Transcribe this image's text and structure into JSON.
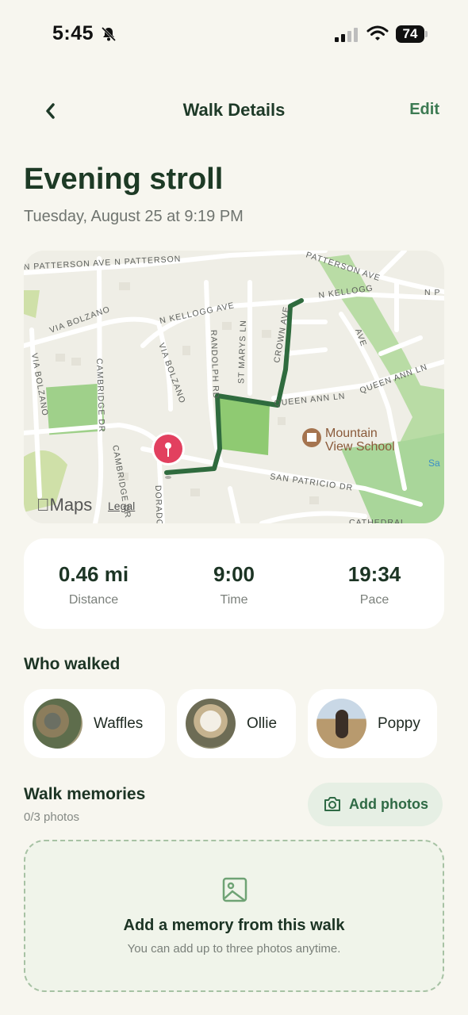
{
  "status_bar": {
    "time": "5:45",
    "battery": "74"
  },
  "nav": {
    "title": "Walk Details",
    "edit_label": "Edit"
  },
  "walk": {
    "title": "Evening stroll",
    "date": "Tuesday, August 25 at 9:19 PM"
  },
  "map": {
    "streets": [
      "N PATTERSON AVE",
      "N PATTERSON",
      "PATTERSON AVE",
      "N P",
      "N KELLOGG AVE",
      "N KELLOGG",
      "AVE",
      "VIA BOLZANO",
      "VIA BOLZANO",
      "VIA BOLZANO",
      "RANDOLPH RD",
      "ST MARYS LN",
      "CROWN AVE",
      "CAMBRIDGE DR",
      "CAMBRIDGE DR",
      "QUEEN ANN LN",
      "QUEEN ANN LN",
      "SAN PATRICIO DR",
      "DORADO",
      "CATHEDRAL"
    ],
    "poi": [
      "Mountain",
      "View School"
    ],
    "attribution": "Maps",
    "legal": "Legal",
    "route_color": "#2f6b3e"
  },
  "stats": [
    {
      "value": "0.46 mi",
      "label": "Distance"
    },
    {
      "value": "9:00",
      "label": "Time"
    },
    {
      "value": "19:34",
      "label": "Pace"
    }
  ],
  "who_walked": {
    "heading": "Who walked",
    "dogs": [
      {
        "name": "Waffles"
      },
      {
        "name": "Ollie"
      },
      {
        "name": "Poppy"
      }
    ]
  },
  "memories": {
    "heading": "Walk memories",
    "count": "0/3 photos",
    "add_label": "Add photos",
    "empty_title": "Add a memory from this walk",
    "empty_sub": "You can add up to three photos anytime."
  },
  "colors": {
    "accent": "#2f6a45",
    "background": "#f7f6ef"
  }
}
